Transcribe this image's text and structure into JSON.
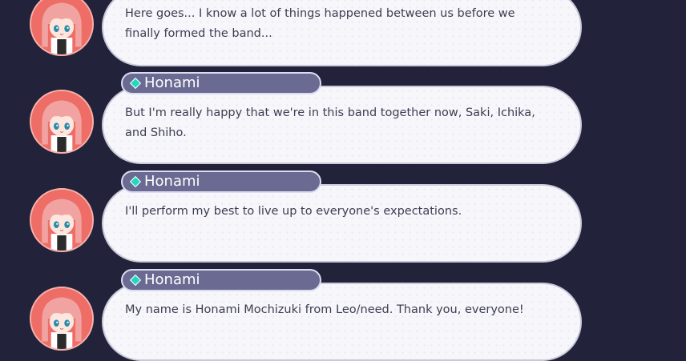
{
  "dialogue": [
    {
      "speaker": "",
      "text": "Here goes... I know a lot of things happened between us before we finally formed the band..."
    },
    {
      "speaker": "Honami",
      "text": "But I'm really happy that we're in this band together now, Saki, Ichika, and Shiho."
    },
    {
      "speaker": "Honami",
      "text": "I'll perform my best to live up to everyone's expectations."
    },
    {
      "speaker": "Honami",
      "text": "My name is Honami Mochizuki from Leo/need. Thank you, everyone!"
    }
  ],
  "colors": {
    "background": "#22223a",
    "nameplate": "#6a6a92",
    "accent_diamond": "#23d9bd",
    "avatar_ring": "#ee6d67",
    "bubble": "#f6f6fb"
  },
  "icons": {
    "avatar": "honami-avatar-icon",
    "speaker_marker": "diamond-icon"
  }
}
